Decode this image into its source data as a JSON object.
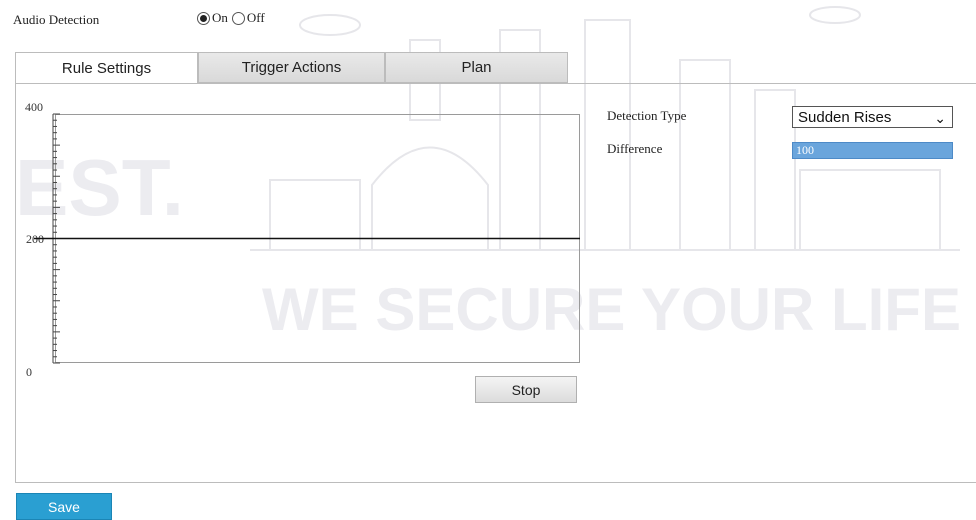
{
  "audio_detection": {
    "label": "Audio Detection",
    "options": [
      {
        "label": "On",
        "selected": true
      },
      {
        "label": "Off",
        "selected": false
      }
    ]
  },
  "tabs": [
    {
      "label": "Rule Settings",
      "active": true
    },
    {
      "label": "Trigger Actions",
      "active": false
    },
    {
      "label": "Plan",
      "active": false
    }
  ],
  "graph": {
    "y_ticks": [
      "400",
      "200",
      "0"
    ],
    "threshold_value": 200,
    "y_max": 400
  },
  "stop_button": {
    "label": "Stop"
  },
  "detection_type": {
    "label": "Detection Type",
    "value": "Sudden Rises"
  },
  "difference": {
    "label": "Difference",
    "value": "100"
  },
  "save_button": {
    "label": "Save"
  },
  "watermark": {
    "text": "WE SECURE YOUR LIFE",
    "partial": "EST."
  },
  "colors": {
    "save": "#2a9fd2",
    "input_highlight": "#6aa5dc"
  }
}
